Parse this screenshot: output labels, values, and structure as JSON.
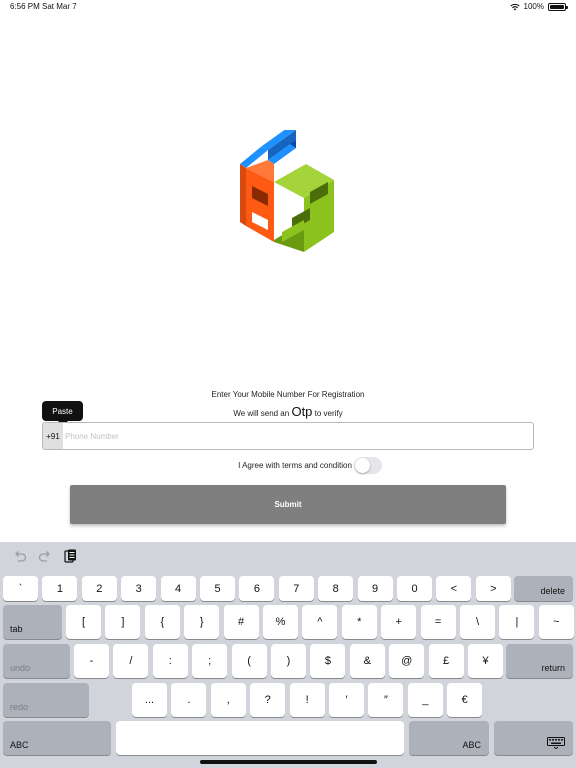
{
  "status_bar": {
    "time": "6:56 PM",
    "date": "Sat Mar 7",
    "battery": "100%"
  },
  "form": {
    "instruction_line1": "Enter Your Mobile Number For Registration",
    "instruction_line2_prefix": "We will send an",
    "instruction_line2_otp": "Otp",
    "instruction_line2_suffix": "to verify",
    "paste_label": "Paste",
    "country_code": "+91",
    "phone_placeholder": "Phone Number",
    "phone_value": "",
    "agree_label": "I Agree with terms and condition",
    "agree_checked": false,
    "submit_label": "Submit"
  },
  "keyboard": {
    "row1": [
      "`",
      "1",
      "2",
      "3",
      "4",
      "5",
      "6",
      "7",
      "8",
      "9",
      "0",
      "<",
      ">"
    ],
    "delete_label": "delete",
    "tab_label": "tab",
    "row2": [
      "[",
      "]",
      "{",
      "}",
      "#",
      "%",
      "^",
      "*",
      "+",
      "=",
      "\\",
      "|",
      "~"
    ],
    "undo_label": "undo",
    "row3": [
      "-",
      "/",
      ":",
      ";",
      "(",
      ")",
      "$",
      "&",
      "@",
      "£",
      "¥"
    ],
    "return_label": "return",
    "redo_label": "redo",
    "row4": [
      "...",
      ".",
      ",",
      "?",
      "!",
      "′",
      "″",
      "_",
      "€"
    ],
    "abc_left_label": "ABC",
    "abc_right_label": "ABC"
  },
  "colors": {
    "logo_blue": "#1e90ff",
    "logo_orange": "#ff5a14",
    "logo_green": "#8cc21e",
    "submit_bg": "#7f7f7f",
    "keyboard_bg": "#d1d4da"
  }
}
